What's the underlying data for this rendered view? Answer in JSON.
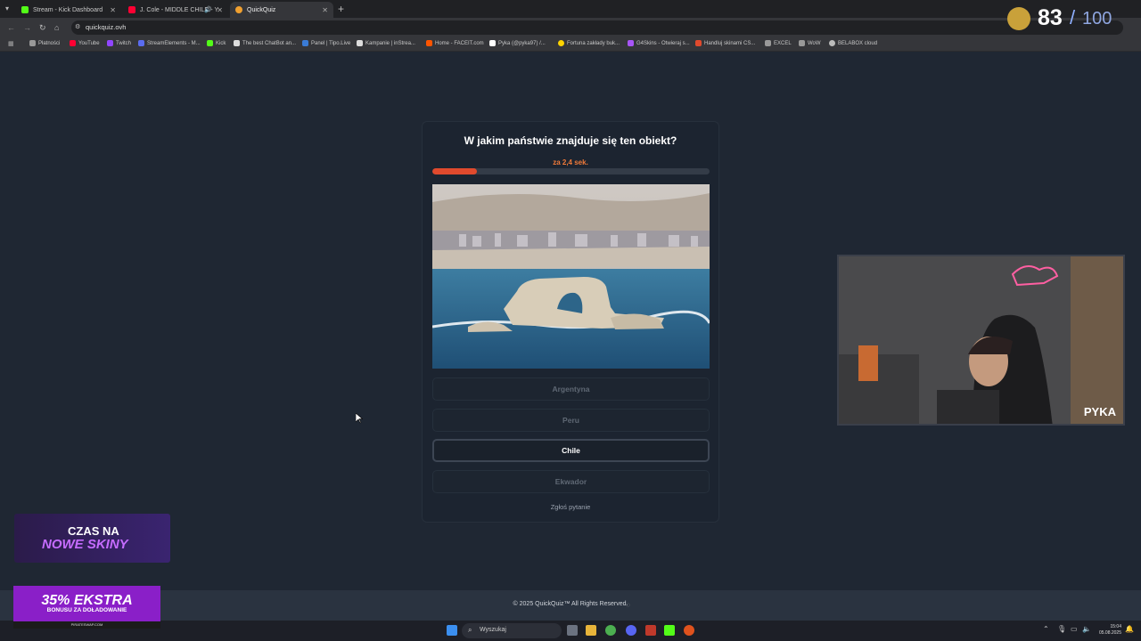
{
  "browser": {
    "tabs": [
      {
        "title": "Stream - Kick Dashboard",
        "favicon_color": "#53fc18",
        "active": false
      },
      {
        "title": "J. Cole - MIDDLE CHILD - Y",
        "favicon_color": "#ff0033",
        "active": false
      },
      {
        "title": "QuickQuiz",
        "favicon_color": "#f0a030",
        "active": true
      }
    ],
    "url": "quickquiz.ovh",
    "bookmarks": [
      {
        "label": "Płatności",
        "color": "#999"
      },
      {
        "label": "YouTube",
        "color": "#ff0033"
      },
      {
        "label": "Twitch",
        "color": "#9146ff"
      },
      {
        "label": "StreamElements - M...",
        "color": "#5a6cf0"
      },
      {
        "label": "Kick",
        "color": "#53fc18"
      },
      {
        "label": "The best ChatBot an...",
        "color": "#ddd"
      },
      {
        "label": "Panel | Tipo.Live",
        "color": "#3a7bd5"
      },
      {
        "label": "Kampanie | inStrea...",
        "color": "#ddd"
      },
      {
        "label": "Home - FACEIT.com",
        "color": "#ff5500"
      },
      {
        "label": "Pyka (@pyka97) /...",
        "color": "#fff"
      },
      {
        "label": "Fortuna zakłady buk...",
        "color": "#ffd400"
      },
      {
        "label": "G4Skins - Otwieraj s...",
        "color": "#a855f7"
      },
      {
        "label": "Handluj skinami CS...",
        "color": "#e04a2d"
      },
      {
        "label": "EXCEL",
        "color": "#999"
      },
      {
        "label": "WoW",
        "color": "#999"
      },
      {
        "label": "BELABOX cloud",
        "color": "#bbb"
      }
    ]
  },
  "quiz": {
    "question": "W jakim państwie znajduje się ten obiekt?",
    "timer_text": "za 2,4 sek.",
    "progress_fraction": 0.16,
    "answers": [
      {
        "label": "Argentyna",
        "selected": false
      },
      {
        "label": "Peru",
        "selected": false
      },
      {
        "label": "Chile",
        "selected": true
      },
      {
        "label": "Ekwador",
        "selected": false
      }
    ],
    "report_label": "Zgłoś pytanie"
  },
  "footer": {
    "text": "© 2025  QuickQuiz™ All Rights Reserved."
  },
  "overlay": {
    "score": "83",
    "score_sep": "/",
    "score_total": "100",
    "streamer_name": "PYKA",
    "promo1_line1": "CZAS NA",
    "promo1_line2": "NOWE SKINY",
    "promo2_line1": "35% EKSTRA",
    "promo2_line2": "BONUSU ZA DOŁADOWANIE",
    "promo2_line3": "PIRATESWAP.COM"
  },
  "taskbar": {
    "search_placeholder": "Wyszukaj",
    "time": "15:04",
    "date": "05.08.2025"
  }
}
